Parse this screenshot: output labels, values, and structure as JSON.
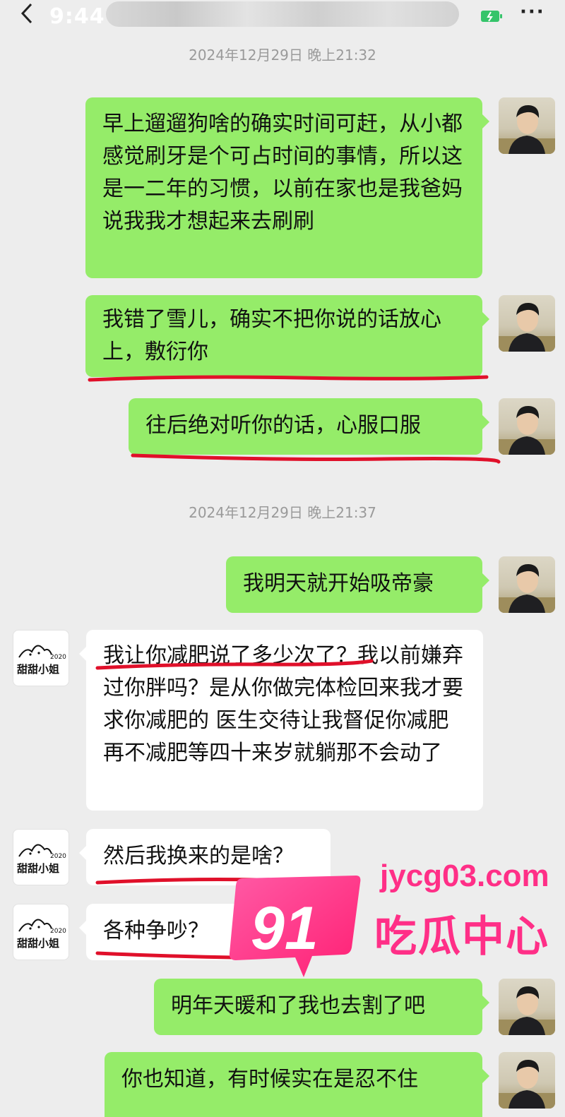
{
  "status": {
    "time": "9:44",
    "more": "···"
  },
  "timestamps": [
    "2024年12月29日 晚上21:32",
    "2024年12月29日 晚上21:37"
  ],
  "messages": [
    {
      "side": "right",
      "text": "早上遛遛狗啥的确实时间可赶，从小都感觉刷牙是个可占时间的事情，所以这是一二年的习惯，以前在家也是我爸妈说我我才想起来去刷刷"
    },
    {
      "side": "right",
      "text": "我错了雪儿，确实不把你说的话放心上，敷衍你"
    },
    {
      "side": "right",
      "text": "往后绝对听你的话，心服口服"
    },
    {
      "side": "right",
      "text": "我明天就开始吸帝豪"
    },
    {
      "side": "left",
      "text": "我让你减肥说了多少次了？我以前嫌弃过你胖吗？是从你做完体检回来我才要求你减肥的 医生交待让我督促你减肥 再不减肥等四十来岁就躺那不会动了"
    },
    {
      "side": "left",
      "text": "然后我换来的是啥？"
    },
    {
      "side": "left",
      "text": "各种争吵？"
    },
    {
      "side": "right",
      "text": "明年天暖和了我也去割了吧"
    },
    {
      "side": "right",
      "text": "你也知道，有时候实在是忍不住"
    }
  ],
  "avatar_her_logo": {
    "brand": "甜甜小姐",
    "year": "2020"
  },
  "watermark": {
    "number": "91",
    "url": "jycg03.com",
    "name": "吃瓜中心"
  },
  "colors": {
    "my_bubble": "#95ec69",
    "her_bubble": "#ffffff",
    "background": "#ededed",
    "underline": "#e0102a",
    "watermark": "#ff2f87"
  }
}
